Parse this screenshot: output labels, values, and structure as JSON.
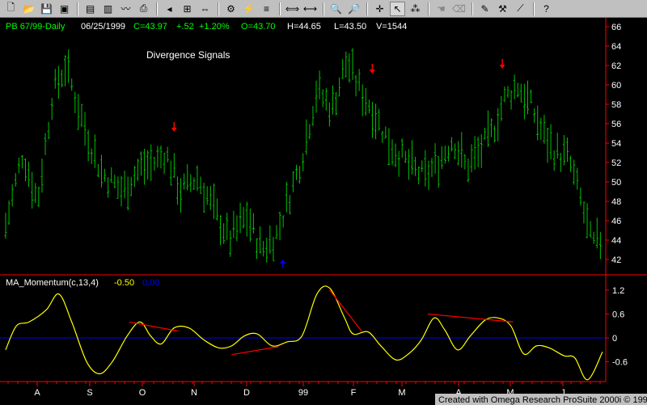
{
  "toolbar": {
    "buttons": [
      {
        "name": "new-icon",
        "glyph": "🗋"
      },
      {
        "name": "open-icon",
        "glyph": "📂"
      },
      {
        "name": "save-icon",
        "glyph": "💾"
      },
      {
        "name": "workspace-icon",
        "glyph": "▣"
      },
      {
        "sep": true
      },
      {
        "name": "print-icon",
        "glyph": "▤"
      },
      {
        "name": "chart-window-icon",
        "glyph": "▥"
      },
      {
        "name": "line-chart-icon",
        "glyph": "〰"
      },
      {
        "name": "printer-icon",
        "glyph": "⎙"
      },
      {
        "sep": true
      },
      {
        "name": "format-icon",
        "glyph": "◂"
      },
      {
        "name": "properties-icon",
        "glyph": "⊞"
      },
      {
        "name": "arrange-icon",
        "glyph": "⇔"
      },
      {
        "sep": true
      },
      {
        "name": "insert-analysis-icon",
        "glyph": "⚙"
      },
      {
        "name": "indicator-icon",
        "glyph": "⚡"
      },
      {
        "name": "strategy-icon",
        "glyph": "≡"
      },
      {
        "sep": true
      },
      {
        "name": "expand-bars-icon",
        "glyph": "⟺"
      },
      {
        "name": "compress-bars-icon",
        "glyph": "⟷"
      },
      {
        "sep": true
      },
      {
        "name": "zoom-in-icon",
        "glyph": "🔍"
      },
      {
        "name": "zoom-out-icon",
        "glyph": "🔎",
        "dim": true
      },
      {
        "sep": true
      },
      {
        "name": "crosshair-icon",
        "glyph": "✛"
      },
      {
        "name": "pointer-icon",
        "glyph": "↖",
        "active": true
      },
      {
        "name": "data-tips-icon",
        "glyph": "⁂"
      },
      {
        "sep": true
      },
      {
        "name": "hand-icon",
        "glyph": "☚",
        "dim": true
      },
      {
        "name": "eraser-icon",
        "glyph": "⌫",
        "dim": true
      },
      {
        "sep": true
      },
      {
        "name": "pencil-icon",
        "glyph": "✎"
      },
      {
        "name": "tools-icon",
        "glyph": "⚒"
      },
      {
        "name": "trendline-icon",
        "glyph": "⟋"
      },
      {
        "sep": true
      },
      {
        "name": "help-icon",
        "glyph": "?"
      }
    ]
  },
  "header": {
    "symbol": "PB 67/99-Daily",
    "date": "06/25/1999",
    "close": "C=43.97",
    "change": "+.52",
    "change_pct": "+1.20%",
    "open": "O=43.70",
    "high": "H=44.65",
    "low": "L=43.50",
    "volume": "V=1544"
  },
  "annotation": "Divergence Signals",
  "indicator": {
    "label": "MA_Momentum(c,13,4)",
    "value1": "-0.50",
    "value2": "0.00"
  },
  "footer": "Created with Omega Research ProSuite 2000i © 1999",
  "colors": {
    "bars": "#00c000",
    "momentum": "#ffff00",
    "zero_line": "#0000ff",
    "divergence": "#ff0000",
    "sell_arrow": "#ff0000",
    "buy_arrow": "#0000ff",
    "axis": "#ff0000",
    "text": "#ffffff",
    "header_green": "#00ff00"
  },
  "chart_data": [
    {
      "type": "bar",
      "subtype": "ohlc",
      "title": "PB 67/99-Daily",
      "ylim": [
        40.6,
        66.8
      ],
      "yticks": [
        42,
        44,
        46,
        48,
        50,
        52,
        54,
        56,
        58,
        60,
        62,
        64,
        66
      ],
      "xticks": [
        "A",
        "S",
        "O",
        "N",
        "D",
        "99",
        "F",
        "M",
        "A",
        "M",
        "J"
      ],
      "approx_bar_count": 180,
      "anchors": [
        {
          "bar": 0,
          "price": 45.5
        },
        {
          "bar": 8,
          "price": 53
        },
        {
          "bar": 15,
          "price": 48
        },
        {
          "bar": 22,
          "price": 59
        },
        {
          "bar": 28,
          "price": 62
        },
        {
          "bar": 38,
          "price": 55
        },
        {
          "bar": 45,
          "price": 51
        },
        {
          "bar": 55,
          "price": 49
        },
        {
          "bar": 63,
          "price": 51.5
        },
        {
          "bar": 70,
          "price": 52
        },
        {
          "bar": 75,
          "price": 53
        },
        {
          "bar": 82,
          "price": 49
        },
        {
          "bar": 90,
          "price": 50.5
        },
        {
          "bar": 98,
          "price": 47
        },
        {
          "bar": 105,
          "price": 44
        },
        {
          "bar": 113,
          "price": 46.5
        },
        {
          "bar": 120,
          "price": 43
        },
        {
          "bar": 127,
          "price": 44.5
        },
        {
          "bar": 133,
          "price": 48.5
        },
        {
          "bar": 139,
          "price": 52.5
        },
        {
          "bar": 146,
          "price": 59.5
        },
        {
          "bar": 153,
          "price": 57.5
        },
        {
          "bar": 160,
          "price": 62.5
        },
        {
          "bar": 165,
          "price": 60
        },
        {
          "bar": 172,
          "price": 57.5
        },
        {
          "bar": 180,
          "price": 54
        },
        {
          "bar": 188,
          "price": 52
        },
        {
          "bar": 196,
          "price": 50.5
        },
        {
          "bar": 203,
          "price": 52
        },
        {
          "bar": 210,
          "price": 54.5
        },
        {
          "bar": 216,
          "price": 51.5
        },
        {
          "bar": 222,
          "price": 53
        },
        {
          "bar": 228,
          "price": 55
        },
        {
          "bar": 234,
          "price": 58.5
        },
        {
          "bar": 240,
          "price": 60
        },
        {
          "bar": 246,
          "price": 58
        },
        {
          "bar": 252,
          "price": 55
        },
        {
          "bar": 258,
          "price": 53
        },
        {
          "bar": 264,
          "price": 52.5
        },
        {
          "bar": 270,
          "price": 48
        },
        {
          "bar": 275,
          "price": 43.5
        },
        {
          "bar": 280,
          "price": 44
        }
      ],
      "signals": [
        {
          "type": "sell",
          "bar": 79,
          "price": 55.5
        },
        {
          "type": "buy",
          "bar": 130,
          "price": 42
        },
        {
          "type": "sell",
          "bar": 172,
          "price": 61.5
        },
        {
          "type": "sell",
          "bar": 233,
          "price": 62
        }
      ]
    },
    {
      "type": "line",
      "title": "MA_Momentum(c,13,4)",
      "ylim": [
        -1.1,
        1.5
      ],
      "yticks": [
        1.2,
        0.6,
        0,
        -0.6
      ],
      "zero_line": 0,
      "points": [
        {
          "bar": 0,
          "v": -0.3
        },
        {
          "bar": 5,
          "v": 0.3
        },
        {
          "bar": 11,
          "v": 0.4
        },
        {
          "bar": 19,
          "v": 0.7
        },
        {
          "bar": 25,
          "v": 1.1
        },
        {
          "bar": 31,
          "v": 0.4
        },
        {
          "bar": 38,
          "v": -0.6
        },
        {
          "bar": 44,
          "v": -0.9
        },
        {
          "bar": 50,
          "v": -0.6
        },
        {
          "bar": 57,
          "v": 0.05
        },
        {
          "bar": 63,
          "v": 0.4
        },
        {
          "bar": 68,
          "v": 0.05
        },
        {
          "bar": 73,
          "v": -0.15
        },
        {
          "bar": 79,
          "v": 0.25
        },
        {
          "bar": 86,
          "v": 0.25
        },
        {
          "bar": 93,
          "v": -0.05
        },
        {
          "bar": 100,
          "v": -0.25
        },
        {
          "bar": 106,
          "v": -0.2
        },
        {
          "bar": 112,
          "v": 0.05
        },
        {
          "bar": 118,
          "v": 0.1
        },
        {
          "bar": 125,
          "v": -0.2
        },
        {
          "bar": 132,
          "v": -0.1
        },
        {
          "bar": 139,
          "v": 0.05
        },
        {
          "bar": 146,
          "v": 1.1
        },
        {
          "bar": 152,
          "v": 1.25
        },
        {
          "bar": 159,
          "v": 0.5
        },
        {
          "bar": 163,
          "v": 0.1
        },
        {
          "bar": 170,
          "v": 0.15
        },
        {
          "bar": 176,
          "v": -0.2
        },
        {
          "bar": 183,
          "v": -0.55
        },
        {
          "bar": 189,
          "v": -0.4
        },
        {
          "bar": 195,
          "v": -0.05
        },
        {
          "bar": 201,
          "v": 0.5
        },
        {
          "bar": 206,
          "v": 0.2
        },
        {
          "bar": 212,
          "v": -0.3
        },
        {
          "bar": 218,
          "v": 0.05
        },
        {
          "bar": 225,
          "v": 0.45
        },
        {
          "bar": 231,
          "v": 0.5
        },
        {
          "bar": 237,
          "v": 0.3
        },
        {
          "bar": 243,
          "v": -0.4
        },
        {
          "bar": 249,
          "v": -0.2
        },
        {
          "bar": 255,
          "v": -0.25
        },
        {
          "bar": 262,
          "v": -0.45
        },
        {
          "bar": 267,
          "v": -0.5
        },
        {
          "bar": 273,
          "v": -1.05
        },
        {
          "bar": 280,
          "v": -0.35
        }
      ],
      "divergence_lines": [
        {
          "from": {
            "bar": 58,
            "v": 0.4
          },
          "to": {
            "bar": 81,
            "v": 0.17
          }
        },
        {
          "from": {
            "bar": 106,
            "v": -0.42
          },
          "to": {
            "bar": 128,
            "v": -0.22
          }
        },
        {
          "from": {
            "bar": 152,
            "v": 1.2
          },
          "to": {
            "bar": 167,
            "v": 0.17
          }
        },
        {
          "from": {
            "bar": 198,
            "v": 0.6
          },
          "to": {
            "bar": 238,
            "v": 0.4
          }
        }
      ]
    }
  ]
}
